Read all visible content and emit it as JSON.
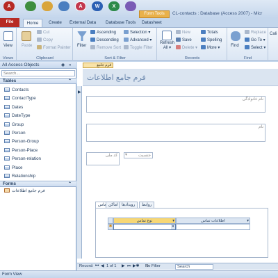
{
  "window": {
    "title": "CL-contacts : Database (Access 2007) - Micr",
    "contextual_tab_header": "Form Tools"
  },
  "ribbon_tabs": {
    "file": "File",
    "home": "Home",
    "create": "Create",
    "external": "External Data",
    "dbtools": "Database Tools",
    "datasheet": "Datasheet"
  },
  "ribbon": {
    "views": {
      "view": "View",
      "group": "Views"
    },
    "clipboard": {
      "paste": "Paste",
      "cut": "Cut",
      "copy": "Copy",
      "format_painter": "Format Painter",
      "group": "Clipboard"
    },
    "sortfilter": {
      "filter": "Filter",
      "ascending": "Ascending",
      "descending": "Descending",
      "remove_sort": "Remove Sort",
      "selection": "Selection",
      "advanced": "Advanced",
      "toggle_filter": "Toggle Filter",
      "group": "Sort & Filter"
    },
    "records": {
      "refresh_all_1": "Refresh",
      "refresh_all_2": "All",
      "new": "New",
      "save": "Save",
      "delete": "Delete",
      "totals": "Totals",
      "spelling": "Spelling",
      "more": "More",
      "group": "Records"
    },
    "find": {
      "find": "Find",
      "replace": "Replace",
      "goto": "Go To",
      "select": "Select",
      "group": "Find"
    },
    "font_partial": "Cali"
  },
  "nav_pane": {
    "header": "All Access Objects",
    "search_placeholder": "Search...",
    "tables_header": "Tables",
    "tables": [
      "Contacts",
      "ContactType",
      "Dates",
      "DateType",
      "Group",
      "Person",
      "Person-Group",
      "Person-Place",
      "Person-relation",
      "Place",
      "Relationship"
    ],
    "forms_header": "Forms",
    "forms": [
      "فرم جامع اطلاعات"
    ]
  },
  "document": {
    "tab_label": "فرم جامع اطلاعات",
    "form_title": "فرم جامع اطلاعات",
    "fields": {
      "name_family": "نام خانوادگی",
      "name": "نام",
      "code": "کد ملی",
      "gender": "جنسیت"
    },
    "subform_tabs": [
      "تماس",
      "اماکن",
      "رویدادها",
      "روابط"
    ],
    "subgrid": {
      "col_type": "نوع تماس",
      "col_info": "اطلاعات تماس"
    }
  },
  "record_nav": {
    "label": "Record:",
    "position": "1 of 1",
    "filter": "No Filter",
    "search": "Search"
  },
  "status": "Form View",
  "colors": {
    "file_tab": "#b72a24",
    "contextual": "#e9b14b",
    "accent": "#1e395b"
  }
}
